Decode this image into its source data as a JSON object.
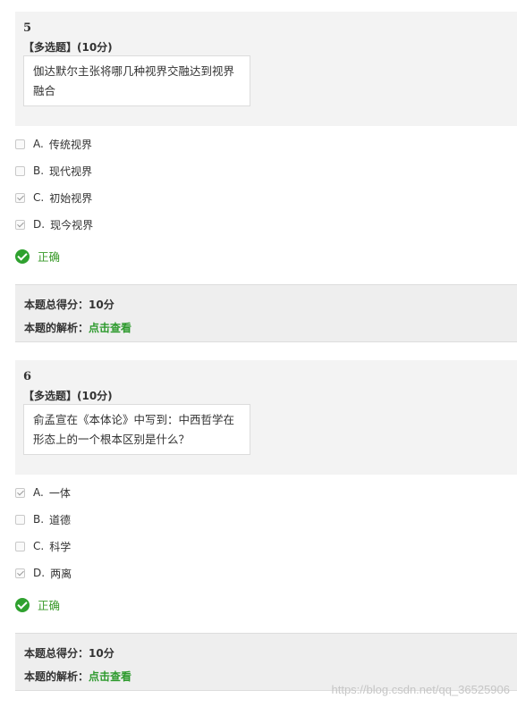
{
  "questions": [
    {
      "number": "5",
      "type": "【多选题】(10分)",
      "text": "伽达默尔主张将哪几种视界交融达到视界融合",
      "options": [
        {
          "letter": "A.",
          "text": "传统视界",
          "checked": false
        },
        {
          "letter": "B.",
          "text": "现代视界",
          "checked": false
        },
        {
          "letter": "C.",
          "text": "初始视界",
          "checked": true
        },
        {
          "letter": "D.",
          "text": "现今视界",
          "checked": true
        }
      ],
      "result": "正确",
      "score_label": "本题总得分：",
      "score_value": "10分",
      "analysis_label": "本题的解析：",
      "analysis_link": "点击查看"
    },
    {
      "number": "6",
      "type": "【多选题】(10分)",
      "text": "俞孟宣在《本体论》中写到：中西哲学在形态上的一个根本区别是什么？",
      "options": [
        {
          "letter": "A.",
          "text": "一体",
          "checked": true
        },
        {
          "letter": "B.",
          "text": "道德",
          "checked": false
        },
        {
          "letter": "C.",
          "text": "科学",
          "checked": false
        },
        {
          "letter": "D.",
          "text": "两离",
          "checked": true
        }
      ],
      "result": "正确",
      "score_label": "本题总得分：",
      "score_value": "10分",
      "analysis_label": "本题的解析：",
      "analysis_link": "点击查看"
    }
  ],
  "watermark": "https://blog.csdn.net/qq_36525906",
  "colors": {
    "correct_green": "#2fa12f",
    "link_green": "#2d9a2d",
    "panel_bg": "#f3f3f3"
  }
}
